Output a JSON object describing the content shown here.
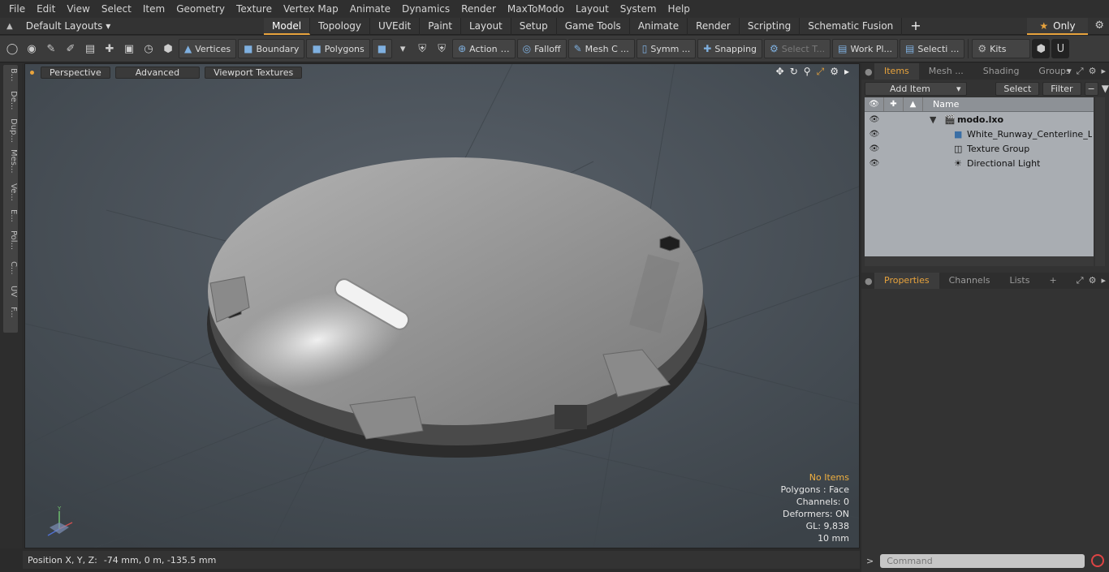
{
  "menu": [
    "File",
    "Edit",
    "View",
    "Select",
    "Item",
    "Geometry",
    "Texture",
    "Vertex Map",
    "Animate",
    "Dynamics",
    "Render",
    "MaxToModo",
    "Layout",
    "System",
    "Help"
  ],
  "layout_selector": {
    "label": "Default Layouts"
  },
  "tabs": [
    "Model",
    "Topology",
    "UVEdit",
    "Paint",
    "Layout",
    "Setup",
    "Game Tools",
    "Animate",
    "Render",
    "Scripting",
    "Schematic Fusion"
  ],
  "only_label": "Only",
  "toolbar": {
    "vertices": "Vertices",
    "boundary": "Boundary",
    "polygons": "Polygons",
    "action": "Action",
    "falloff": "Falloff",
    "mesh_c": "Mesh C ...",
    "symm": "Symm ...",
    "snapping": "Snapping",
    "select_t": "Select T...",
    "work_pl": "Work Pl...",
    "selecti": "Selecti ...",
    "kits": "Kits"
  },
  "left_tabs": [
    "B...",
    "De...",
    "Dup...",
    "Mes...",
    "Ve...",
    "E...",
    "Pol...",
    "C...",
    "UV",
    "F..."
  ],
  "viewport": {
    "perspective": "Perspective",
    "advanced": "Advanced",
    "viewport_textures": "Viewport Textures",
    "stats": {
      "no_items": "No Items",
      "polygons": "Polygons : Face",
      "channels": "Channels: 0",
      "deformers": "Deformers: ON",
      "gl": "GL: 9,838",
      "scale": "10 mm"
    }
  },
  "status": {
    "label": "Position X, Y, Z:",
    "value": "-74 mm, 0 m, -135.5 mm"
  },
  "items_panel": {
    "tabs": [
      "Items",
      "Mesh ...",
      "Shading",
      "Groups"
    ],
    "add_item": "Add Item",
    "select": "Select",
    "filter": "Filter",
    "name_header": "Name",
    "tree": [
      {
        "label": "modo.lxo"
      },
      {
        "label": "White_Runway_Centerline_Li..."
      },
      {
        "label": "Texture Group"
      },
      {
        "label": "Directional Light"
      }
    ]
  },
  "props_panel": {
    "tabs": [
      "Properties",
      "Channels",
      "Lists"
    ]
  },
  "command": {
    "placeholder": "Command"
  }
}
